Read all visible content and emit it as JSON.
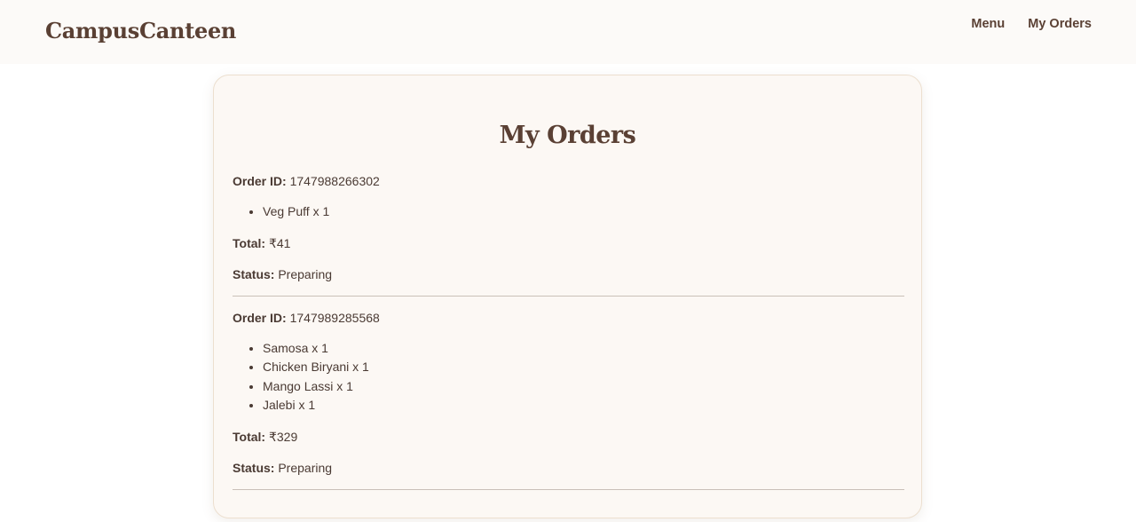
{
  "header": {
    "brand": "CampusCanteen",
    "nav": [
      "Menu",
      "My Orders"
    ]
  },
  "page": {
    "title": "My Orders",
    "labels": {
      "order_id": "Order ID:",
      "total": "Total:",
      "status": "Status:"
    }
  },
  "orders": [
    {
      "id": "1747988266302",
      "items": [
        "Veg Puff x 1"
      ],
      "total": "₹41",
      "status": "Preparing"
    },
    {
      "id": "1747989285568",
      "items": [
        "Samosa x 1",
        "Chicken Biryani x 1",
        "Mango Lassi x 1",
        "Jalebi x 1"
      ],
      "total": "₹329",
      "status": "Preparing"
    }
  ],
  "colors": {
    "brand": "#5a4034",
    "text": "#4a3a33",
    "card_bg": "#fcf8f4",
    "header_bg": "#fcfaf8",
    "divider": "#c9c0b8"
  }
}
